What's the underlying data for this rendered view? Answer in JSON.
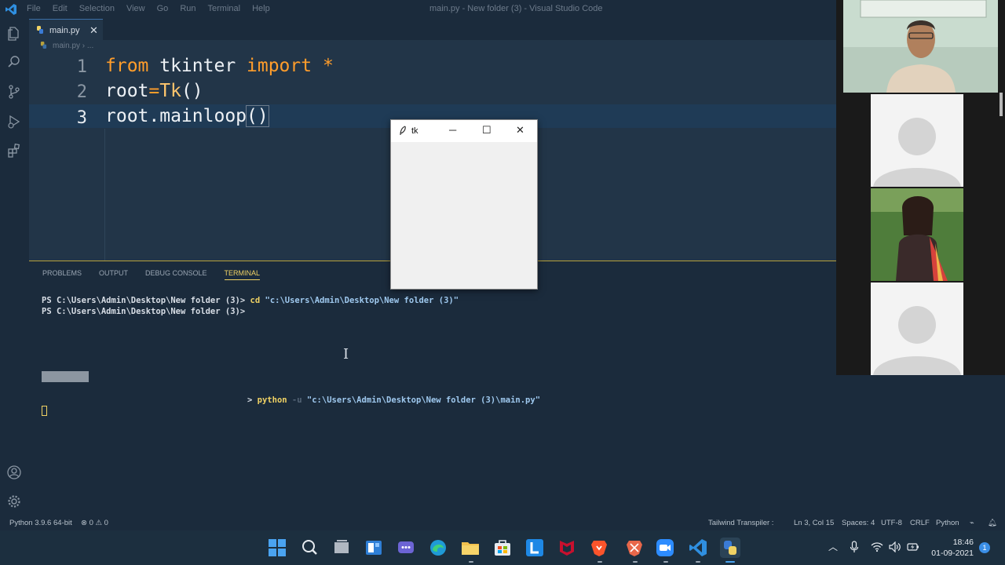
{
  "window": {
    "menu": [
      "File",
      "Edit",
      "Selection",
      "View",
      "Go",
      "Run",
      "Terminal",
      "Help"
    ],
    "title": "main.py - New folder (3) - Visual Studio Code"
  },
  "tabs": [
    {
      "label": "main.py",
      "close": "✕"
    }
  ],
  "breadcrumb": {
    "file": "main.py",
    "trail": "› ..."
  },
  "editor": {
    "lines": [
      {
        "num": "1",
        "kw1": "from",
        "mid": " tkinter ",
        "kw2": "import",
        "end": " *"
      },
      {
        "num": "2",
        "var": "root",
        "op": "=",
        "fn": "Tk",
        "paren": "()"
      },
      {
        "num": "3",
        "text": "root.mainloop",
        "paren": "()"
      }
    ],
    "current_line": 3
  },
  "panel": {
    "tabs": [
      "PROBLEMS",
      "OUTPUT",
      "DEBUG CONSOLE",
      "TERMINAL"
    ],
    "active_tab": "TERMINAL",
    "line1_prompt": "PS C:\\Users\\Admin\\Desktop\\New folder (3)>",
    "line1_cmd": "cd",
    "line1_arg": "\"c:\\Users\\Admin\\Desktop\\New folder (3)\"",
    "line2_prompt": "PS C:\\Users\\Admin\\Desktop\\New folder (3)>",
    "run_caret": ">",
    "run_cmd": "python",
    "run_flag": "-u",
    "run_arg": "\"c:\\Users\\Admin\\Desktop\\New folder (3)\\main.py\""
  },
  "tk_window": {
    "title": "tk",
    "min": "─",
    "max": "☐",
    "close": "✕"
  },
  "status": {
    "python": "Python 3.9.6 64-bit",
    "problems": "⊗ 0 ⚠ 0",
    "tailwind": "Tailwind Transpiler :",
    "position": "Ln 3, Col 15",
    "spaces": "Spaces: 4",
    "encoding": "UTF-8",
    "eol": "CRLF",
    "language": "Python"
  },
  "taskbar": {
    "time": "18:46",
    "date": "01-09-2021",
    "notifications": "1",
    "icons": [
      "windows-start",
      "search",
      "task-view",
      "widgets",
      "teams-chat",
      "edge",
      "file-explorer",
      "store",
      "l-app",
      "mcafee",
      "brave",
      "brave-beta",
      "zoom",
      "vscode",
      "python"
    ]
  },
  "colors": {
    "accent": "#f0d264",
    "keyword": "#ff9d2b",
    "editor_bg": "#223548",
    "panel_bg": "#1b2b3c"
  }
}
